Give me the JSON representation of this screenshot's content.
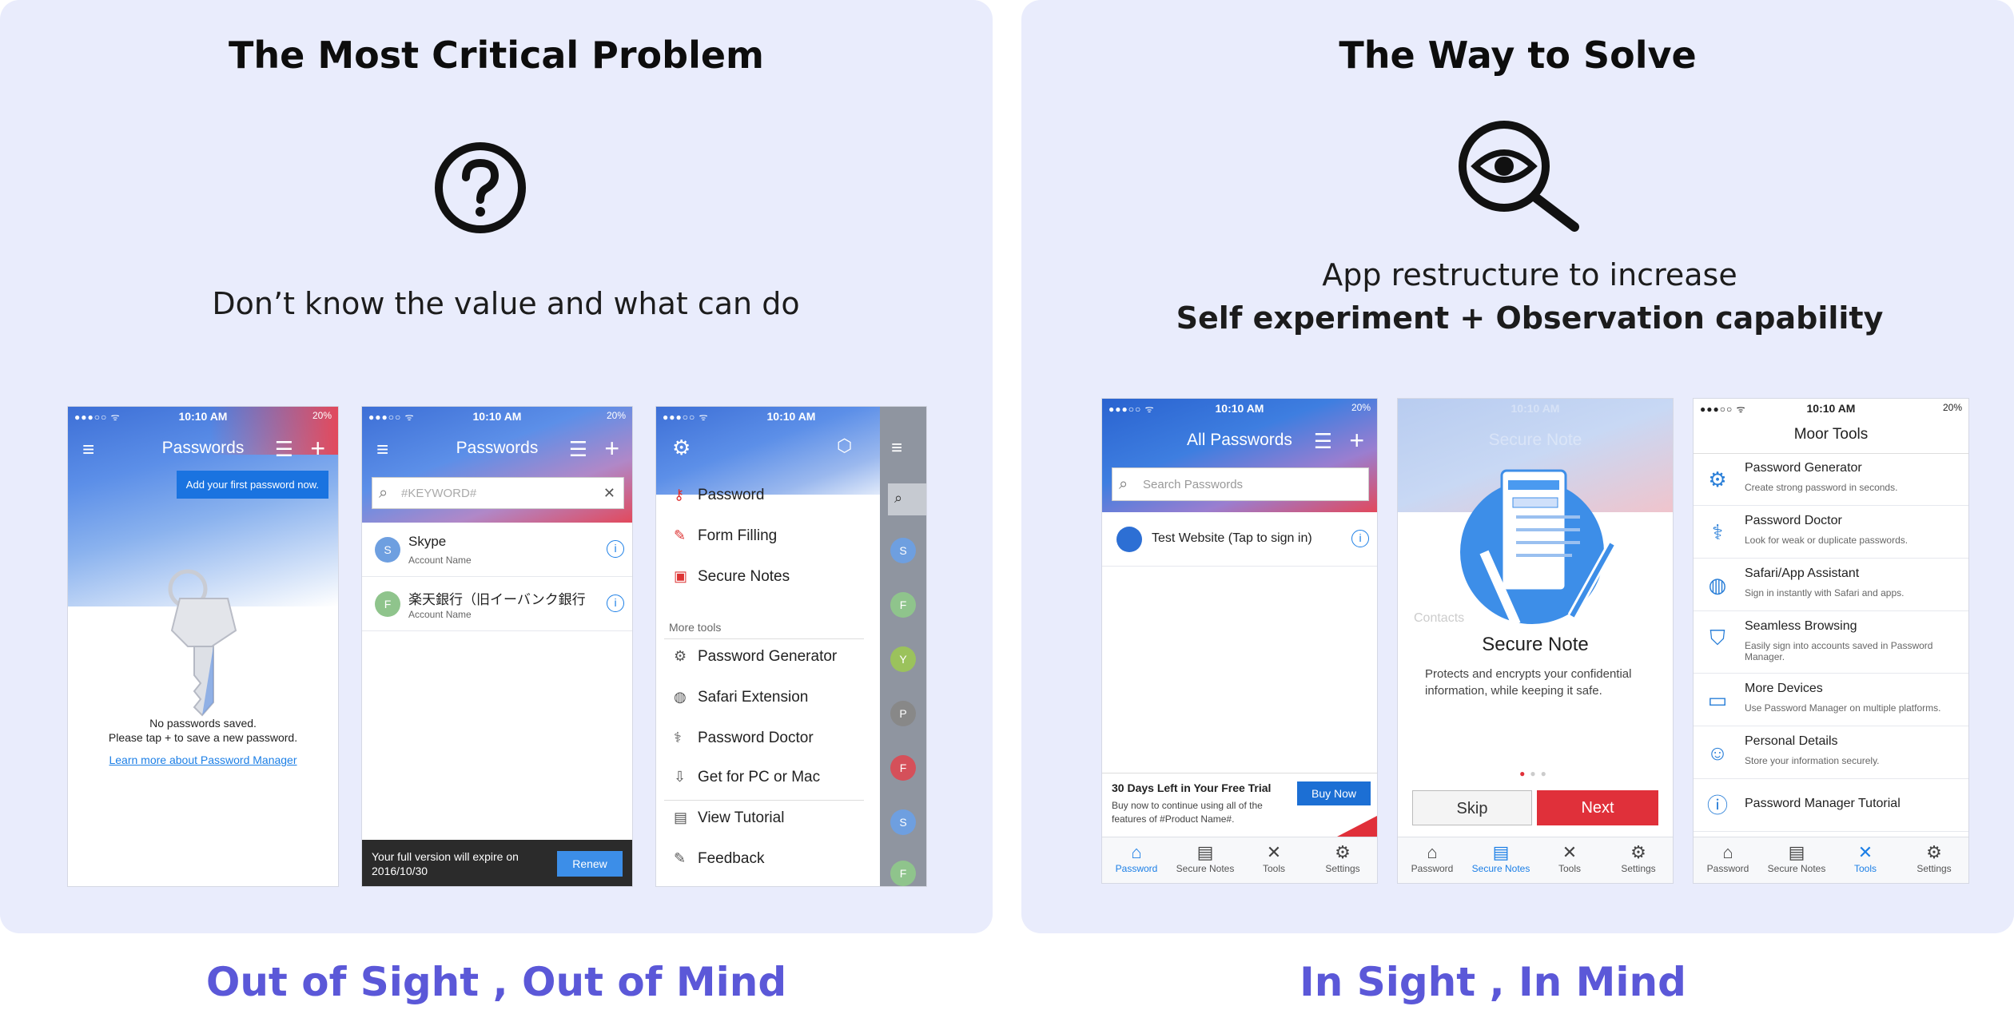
{
  "left": {
    "title": "The Most Critical Problem",
    "subtitle": "Don’t know the value and what can do",
    "bottom": "Out of Sight , Out of Mind"
  },
  "right": {
    "title": "The Way to Solve",
    "subtitle_line1": "App restructure to increase",
    "subtitle_line2": "Self experiment + Observation capability",
    "bottom": "In Sight , In Mind"
  },
  "status": {
    "time": "10:10 AM",
    "battery": "20%"
  },
  "phone1": {
    "title": "Passwords",
    "tooltip": "Add your first password now.",
    "empty_line1": "No passwords saved.",
    "empty_line2": "Please tap + to save a new password.",
    "learn_link": "Learn more about Password Manager"
  },
  "phone2": {
    "title": "Passwords",
    "search_placeholder": "#KEYWORD#",
    "items": [
      {
        "initial": "S",
        "name": "Skype",
        "sub": "Account Name"
      },
      {
        "initial": "F",
        "name": "楽天銀行（旧イーバンク銀行",
        "sub": "Account Name"
      }
    ],
    "expire_text": "Your full version will expire on 2016/10/30",
    "renew": "Renew"
  },
  "phone3": {
    "menu": [
      "Password",
      "Form Filling",
      "Secure Notes"
    ],
    "more_tools_label": "More tools",
    "tools": [
      "Password Generator",
      "Safari Extension",
      "Password Doctor",
      "Get for PC or Mac",
      "View Tutorial",
      "Feedback"
    ],
    "side_initials": [
      "S",
      "F",
      "Y",
      "P",
      "F",
      "S",
      "F"
    ]
  },
  "phone4": {
    "title": "All Passwords",
    "search_placeholder": "Search Passwords",
    "item": "Test Website (Tap to sign in)",
    "trial_title": "30 Days Left in Your Free Trial",
    "trial_desc": "Buy now to continue using all of the features of #Product Name#.",
    "buy_now": "Buy Now"
  },
  "phone5": {
    "ghost_title": "Secure Note",
    "ghost_rows": [
      "Contacts"
    ],
    "note_title": "Secure Note",
    "note_desc": "Protects and encrypts your confidential information, while keeping it safe.",
    "skip": "Skip",
    "next": "Next"
  },
  "phone6": {
    "title": "Moor Tools",
    "tools": [
      {
        "name": "Password Generator",
        "desc": "Create strong password in seconds.",
        "icon": "generator-icon"
      },
      {
        "name": "Password Doctor",
        "desc": "Look for weak or duplicate passwords.",
        "icon": "doctor-icon"
      },
      {
        "name": "Safari/App Assistant",
        "desc": "Sign in instantly with Safari and apps.",
        "icon": "assistant-icon"
      },
      {
        "name": "Seamless Browsing",
        "desc": "Easily sign into accounts saved in Password Manager.",
        "icon": "shield-icon"
      },
      {
        "name": "More Devices",
        "desc": "Use Password Manager on multiple platforms.",
        "icon": "devices-icon"
      },
      {
        "name": "Personal Details",
        "desc": "Store your information securely.",
        "icon": "person-icon"
      },
      {
        "name": "Password Manager Tutorial",
        "desc": "",
        "icon": "tutorial-icon"
      }
    ]
  },
  "tabs": [
    "Password",
    "Secure Notes",
    "Tools",
    "Settings"
  ],
  "colors": {
    "accent": "#5b58d8",
    "panel_bg": "#e9ecfc",
    "blue": "#1c7fe6",
    "red": "#e0303a"
  }
}
